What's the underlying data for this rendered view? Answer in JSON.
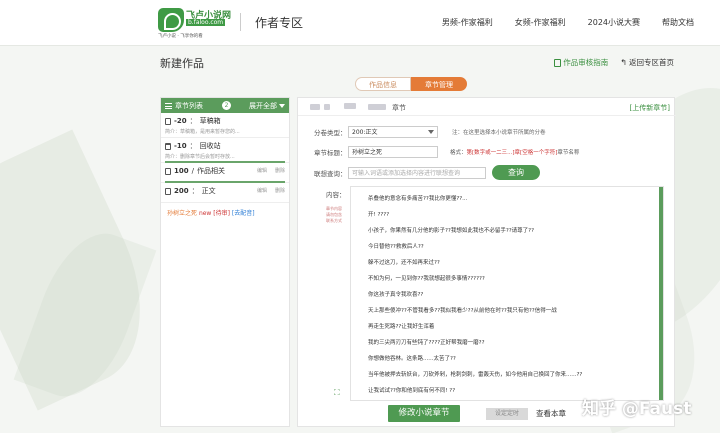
{
  "header": {
    "logo_text": "飞卢小说网",
    "logo_url": "b.faloo.com",
    "logo_slogan": "飞卢小说 · 飞享你的看",
    "section": "作者专区",
    "nav": [
      "男频-作家福利",
      "女频-作家福利",
      "2024小说大赛",
      "帮助文档"
    ]
  },
  "page": {
    "title": "新建作品",
    "review_guide": "作品审核指南",
    "back_home": "返回专区首页"
  },
  "tabs": [
    {
      "label": "作品信息",
      "active": false
    },
    {
      "label": "章节管理",
      "active": true
    }
  ],
  "sidebar": {
    "title": "章节列表",
    "count": "2",
    "expand": "展开全部",
    "volumes": [
      {
        "id": "-20",
        "name": "草稿箱",
        "desc": "简介：草稿箱，是用来暂存您的...",
        "actions": []
      },
      {
        "id": "-10",
        "name": "回收站",
        "desc": "简介：删除章节后会暂时存放...",
        "actions": []
      },
      {
        "id": "100",
        "name": "作品相关",
        "desc": "",
        "actions": [
          "编辑",
          "删除"
        ]
      },
      {
        "id": "200",
        "name": "正文",
        "desc": "",
        "actions": [
          "编辑",
          "删除"
        ]
      }
    ],
    "chapter": {
      "name": "孙树立之死",
      "new_tag": "new",
      "tag": "[待审]",
      "delete": "[去配音]"
    }
  },
  "editor_panel": {
    "chapter_label": "章节",
    "upload_link": "[上传新章节]",
    "volume_label": "分卷类型：",
    "volume_value": "200:正文",
    "volume_hint": "注：在这里选择本小说章节所属的分卷",
    "title_label": "章节标题：",
    "title_value": "孙树立之死",
    "format_label": "格式：",
    "format_red": "第[数字或一二三...]章[空格一个字符]",
    "format_tail": "章节名称",
    "query_label": "联想查询：",
    "query_placeholder": "可输入词语或添加选择内容进行联想查询",
    "query_button": "查询",
    "content_label": "内容：",
    "side_tip": "章节内容请勿包含联系方式",
    "lines": [
      "杀叠他的意念有多痛苦??我比你更懂??...",
      "开!  ????",
      "小孩子，你果然有几分他的影子??我想如此我也不必留手??请尊了??",
      "今日替他??救救后人??",
      "躲不过这刀，还不如再来过??",
      "不知为何，一见到你??我就想起很多事情??????",
      "你这孩子真令我欢喜??",
      "天上那些傻冲??不管我看多??我似我看少??从前他在时??我只有他??信得一战",
      "再走生死路??让我好生浑着",
      "我的三尖两刃刀有些钝了????正好帮我磨一磨??",
      "你想做他吞林。这条路......太苦了??",
      "当年他被押去斩妖台，刀砍斧剁，枪刺剑刺，雷轰天伤，如今他用自己换回了你来......??",
      "让我试试??你和他到底有何不同!  ??"
    ],
    "save_button": "修改小说章节",
    "timer_button": "设定定时",
    "view_link": "查看本章"
  },
  "watermark": "知乎 @Faust",
  "colors": {
    "brand_green": "#4f9a52",
    "tab_orange": "#e47b37",
    "panel_header": "#5b9c5c"
  }
}
